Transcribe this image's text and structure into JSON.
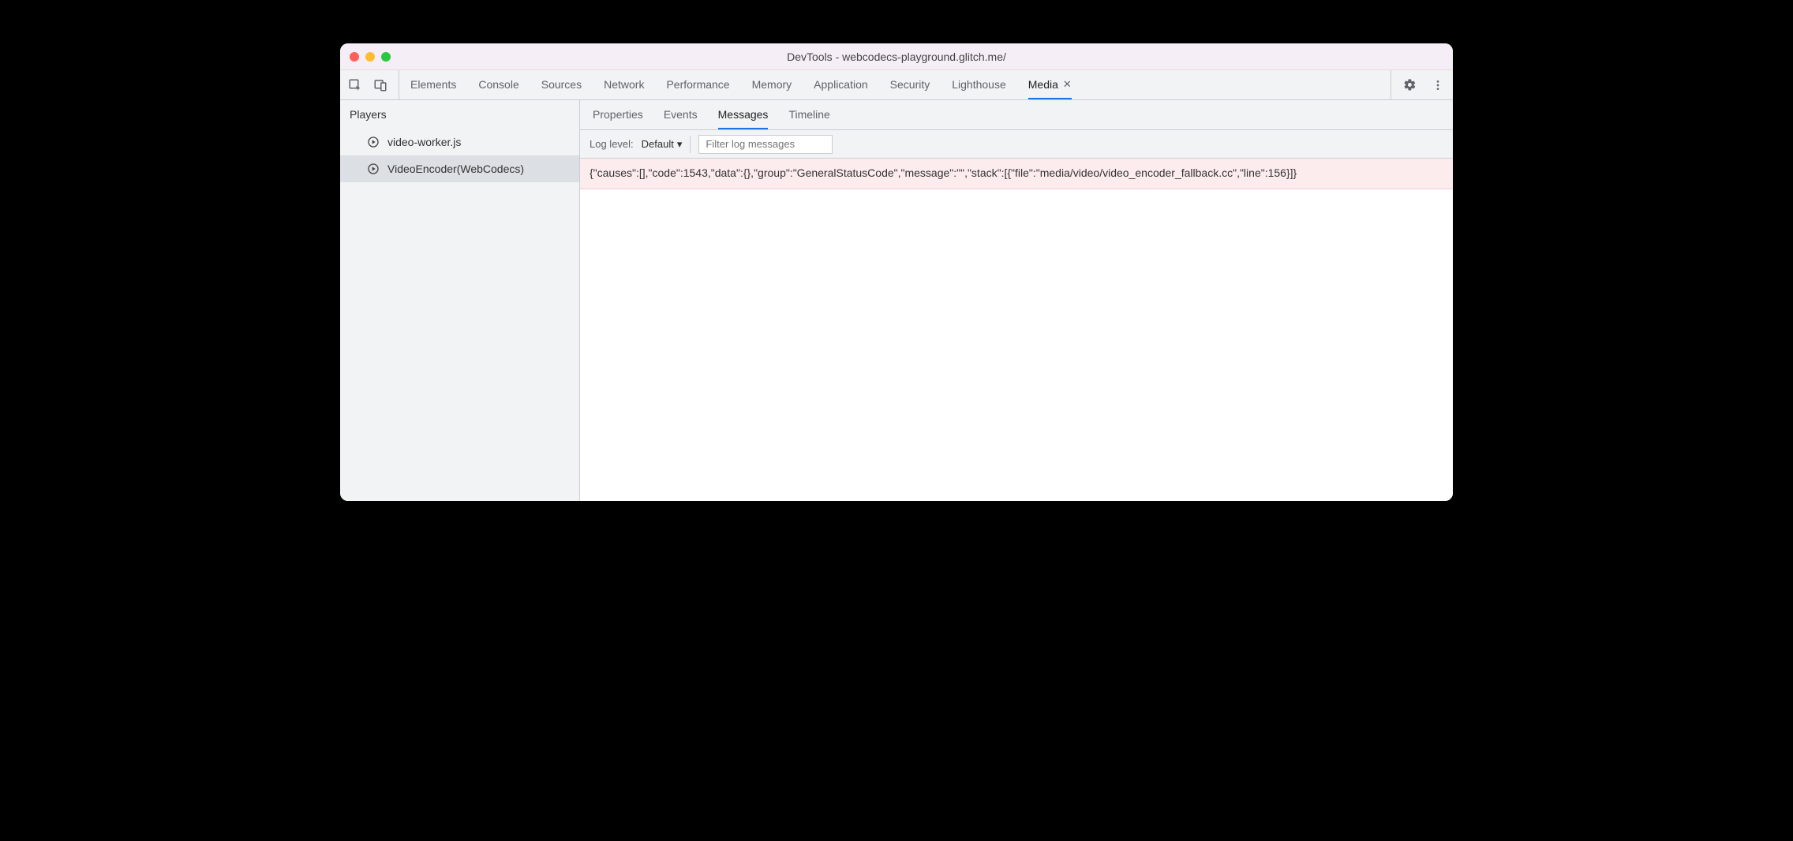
{
  "window": {
    "title": "DevTools - webcodecs-playground.glitch.me/"
  },
  "tabs": {
    "items": [
      {
        "label": "Elements"
      },
      {
        "label": "Console"
      },
      {
        "label": "Sources"
      },
      {
        "label": "Network"
      },
      {
        "label": "Performance"
      },
      {
        "label": "Memory"
      },
      {
        "label": "Application"
      },
      {
        "label": "Security"
      },
      {
        "label": "Lighthouse"
      },
      {
        "label": "Media",
        "active": true,
        "closable": true
      }
    ]
  },
  "sidebar": {
    "heading": "Players",
    "players": [
      {
        "label": "video-worker.js"
      },
      {
        "label": "VideoEncoder(WebCodecs)",
        "selected": true
      }
    ]
  },
  "subtabs": {
    "items": [
      {
        "label": "Properties"
      },
      {
        "label": "Events"
      },
      {
        "label": "Messages",
        "active": true
      },
      {
        "label": "Timeline"
      }
    ]
  },
  "toolbar": {
    "log_level_label": "Log level:",
    "log_level_value": "Default",
    "filter_placeholder": "Filter log messages"
  },
  "logs": {
    "rows": [
      {
        "level": "error",
        "text": "{\"causes\":[],\"code\":1543,\"data\":{},\"group\":\"GeneralStatusCode\",\"message\":\"\",\"stack\":[{\"file\":\"media/video/video_encoder_fallback.cc\",\"line\":156}]}"
      }
    ]
  }
}
